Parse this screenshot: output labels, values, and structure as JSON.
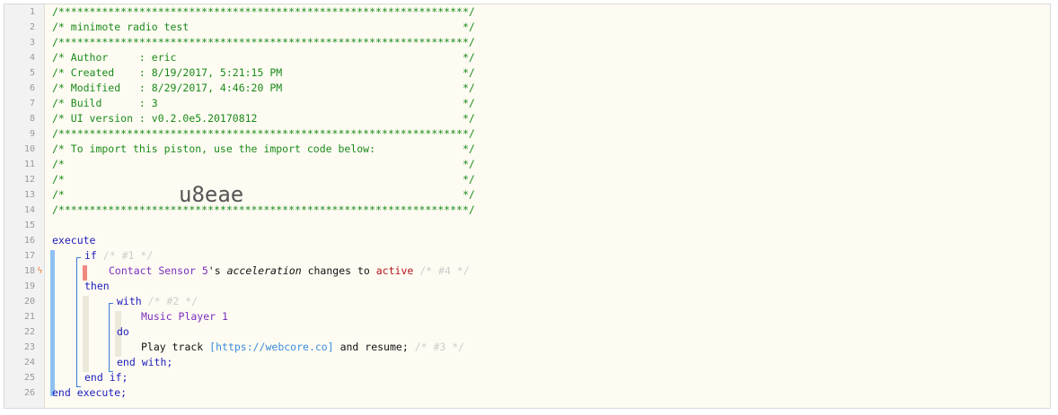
{
  "gutter": {
    "line_numbers": [
      "1",
      "2",
      "3",
      "4",
      "5",
      "6",
      "7",
      "8",
      "9",
      "10",
      "11",
      "12",
      "13",
      "14",
      "15",
      "16",
      "17",
      "18",
      "19",
      "20",
      "21",
      "22",
      "23",
      "24",
      "25",
      "26"
    ],
    "trigger_icon": "lightning-bolt-icon"
  },
  "header": {
    "l1": "/******************************************************************/",
    "l2": "/* minimote radio test                                            */",
    "l3": "/******************************************************************/",
    "l4": "/* Author     : eric                                              */",
    "l5": "/* Created    : 8/19/2017, 5:21:15 PM                             */",
    "l6": "/* Modified   : 8/29/2017, 4:46:20 PM                             */",
    "l7": "/* Build      : 3                                                 */",
    "l8": "/* UI version : v0.2.0e5.20170812                                 */",
    "l9": "/******************************************************************/",
    "l10": "/* To import this piston, use the import code below:              */",
    "l11": "/*                                                                */",
    "l12": "/*                                                                */",
    "l13": "/*                                                                */",
    "l14": "/******************************************************************/",
    "import_code": "u8eae"
  },
  "code": {
    "execute": "execute",
    "if_kw": "if",
    "if_comment": "/* #1 */",
    "cond_device": "Contact Sensor 5",
    "cond_possessive": "'s ",
    "cond_attr": "acceleration",
    "cond_op": " changes to ",
    "cond_value": "active",
    "cond_comment": "/* #4 */",
    "then_kw": "then",
    "with_kw": "with",
    "with_comment": "/* #2 */",
    "with_device": "Music Player 1",
    "do_kw": "do",
    "action_text": "Play track ",
    "action_param": "[https://webcore.co]",
    "action_tail": " and resume;",
    "action_comment": "/* #3 */",
    "end_with": "end with;",
    "end_if": "end if;",
    "end_execute": "end execute;"
  },
  "colors": {
    "comment": "#1a8a1a",
    "keyword": "#1c1cbd",
    "device": "#7a2fc0",
    "value": "#b0141d",
    "url": "#3a8dde",
    "block_bar": "#8ec0f0",
    "condition_marker": "#f08a80"
  }
}
